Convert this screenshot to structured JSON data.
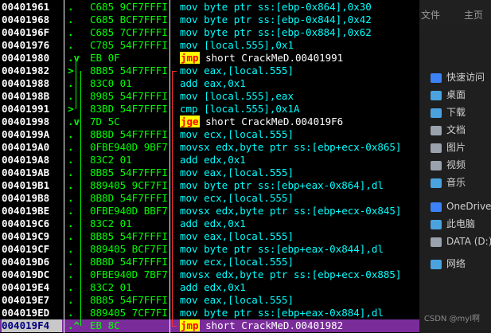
{
  "rows": [
    {
      "addr": "00401961",
      "mark": ".",
      "hex": "C685 9CF7FFFI",
      "dis": "mov byte ptr ss:[ebp-0x864],0x30"
    },
    {
      "addr": "00401968",
      "mark": ".",
      "hex": "C685 BCF7FFFI",
      "dis": "mov byte ptr ss:[ebp-0x844],0x42"
    },
    {
      "addr": "0040196F",
      "mark": ".",
      "hex": "C685 7CF7FFFI",
      "dis": "mov byte ptr ss:[ebp-0x884],0x62"
    },
    {
      "addr": "00401976",
      "mark": ".",
      "hex": "C785 54F7FFFI",
      "dis": "mov [local.555],0x1"
    },
    {
      "addr": "00401980",
      "mark": ".v",
      "hex": "EB 0F",
      "jmp": "jmp",
      "dis": "short CrackMeD.00401991"
    },
    {
      "addr": "00401982",
      "mark": ">",
      "hex": "8B85 54F7FFFI",
      "dis": "mov eax,[local.555]"
    },
    {
      "addr": "00401988",
      "mark": ".",
      "hex": "83C0 01",
      "dis": "add eax,0x1"
    },
    {
      "addr": "0040198B",
      "mark": ".",
      "hex": "8985 54F7FFFI",
      "dis": "mov [local.555],eax"
    },
    {
      "addr": "00401991",
      "mark": ">",
      "hex": "83BD 54F7FFFI",
      "dis": "cmp [local.555],0x1A"
    },
    {
      "addr": "00401998",
      "mark": ".v",
      "hex": "7D 5C",
      "jmp": "jge",
      "dis": "short CrackMeD.004019F6"
    },
    {
      "addr": "0040199A",
      "mark": ".",
      "hex": "8B8D 54F7FFFI",
      "dis": "mov ecx,[local.555]"
    },
    {
      "addr": "004019A0",
      "mark": ".",
      "hex": "0FBE940D 9BF7",
      "dis": "movsx edx,byte ptr ss:[ebp+ecx-0x865]"
    },
    {
      "addr": "004019A8",
      "mark": ".",
      "hex": "83C2 01",
      "dis": "add edx,0x1"
    },
    {
      "addr": "004019AB",
      "mark": ".",
      "hex": "8B85 54F7FFFI",
      "dis": "mov eax,[local.555]"
    },
    {
      "addr": "004019B1",
      "mark": ".",
      "hex": "889405 9CF7FI",
      "dis": "mov byte ptr ss:[ebp+eax-0x864],dl"
    },
    {
      "addr": "004019B8",
      "mark": ".",
      "hex": "8B8D 54F7FFFI",
      "dis": "mov ecx,[local.555]"
    },
    {
      "addr": "004019BE",
      "mark": ".",
      "hex": "0FBE940D BBF7",
      "dis": "movsx edx,byte ptr ss:[ebp+ecx-0x845]"
    },
    {
      "addr": "004019C6",
      "mark": ".",
      "hex": "83C2 01",
      "dis": "add edx,0x1"
    },
    {
      "addr": "004019C9",
      "mark": ".",
      "hex": "8B85 54F7FFFI",
      "dis": "mov eax,[local.555]"
    },
    {
      "addr": "004019CF",
      "mark": ".",
      "hex": "889405 BCF7FI",
      "dis": "mov byte ptr ss:[ebp+eax-0x844],dl"
    },
    {
      "addr": "004019D6",
      "mark": ".",
      "hex": "8B8D 54F7FFFI",
      "dis": "mov ecx,[local.555]"
    },
    {
      "addr": "004019DC",
      "mark": ".",
      "hex": "0FBE940D 7BF7",
      "dis": "movsx edx,byte ptr ss:[ebp+ecx-0x885]"
    },
    {
      "addr": "004019E4",
      "mark": ".",
      "hex": "83C2 01",
      "dis": "add edx,0x1"
    },
    {
      "addr": "004019E7",
      "mark": ".",
      "hex": "8B85 54F7FFFI",
      "dis": "mov eax,[local.555]"
    },
    {
      "addr": "004019ED",
      "mark": ".",
      "hex": "889405 7CF7FI",
      "dis": "mov byte ptr ss:[ebp+eax-0x884],dl"
    },
    {
      "addr": "004019F4",
      "mark": ".^",
      "hex": "EB 8C",
      "jmp": "jmp",
      "dis": "short CrackMeD.00401982",
      "current": true
    }
  ],
  "ghost": {
    "tabs": [
      "文件",
      "主页"
    ],
    "items": [
      {
        "label": "快速访问",
        "color": "#3b82f6"
      },
      {
        "label": "桌面",
        "color": "#4aa3df"
      },
      {
        "label": "下载",
        "color": "#4aa3df"
      },
      {
        "label": "文档",
        "color": "#9aa3ad"
      },
      {
        "label": "图片",
        "color": "#9aa3ad"
      },
      {
        "label": "视频",
        "color": "#9aa3ad"
      },
      {
        "label": "音乐",
        "color": "#4aa3df"
      },
      {
        "label": "OneDrive",
        "color": "#3b82f6"
      },
      {
        "label": "此电脑",
        "color": "#4aa3df"
      },
      {
        "label": "DATA (D:)",
        "color": "#9aa3ad"
      },
      {
        "label": "网络",
        "color": "#4aa3df"
      }
    ]
  },
  "watermark": "CSDN @myl啊"
}
